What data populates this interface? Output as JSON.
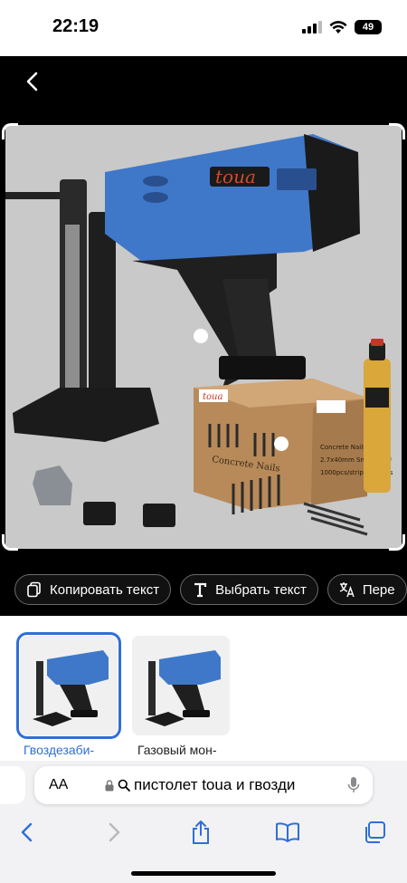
{
  "status": {
    "time": "22:19",
    "battery": "49"
  },
  "actions": [
    {
      "label": "Копировать текст",
      "icon": "copy-icon"
    },
    {
      "label": "Выбрать текст",
      "icon": "text-select-icon"
    },
    {
      "label": "Пере",
      "icon": "translate-icon"
    }
  ],
  "product_image": {
    "brand": "toua",
    "box_brand": "toua",
    "box_label": "Concrete Nails",
    "box_side_lines": [
      "Concrete Nails",
      "2.7x40mm Smooth EU",
      "1000pcs/strip, 10strips"
    ]
  },
  "thumbnails": [
    {
      "caption": "Гвоздезаби-",
      "selected": true
    },
    {
      "caption": "Газовый мон-",
      "selected": false
    }
  ],
  "address_bar": {
    "aa_label": "AA",
    "url_text": "пистолет toua и гвозди"
  },
  "colors": {
    "accent": "#2f6fd6",
    "tool_blue": "#3f78c9",
    "box_brown": "#b88a5a"
  }
}
